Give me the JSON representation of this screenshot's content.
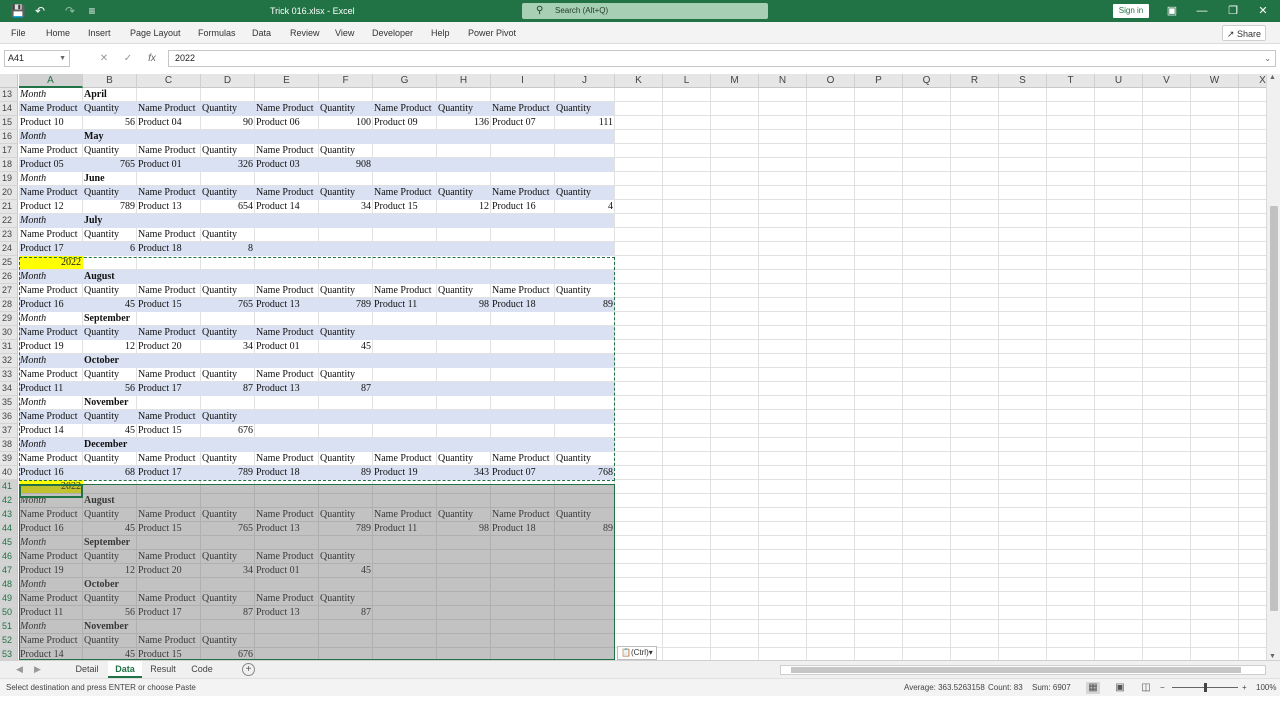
{
  "titlebar": {
    "doc_title": "Trick 016.xlsx  -  Excel",
    "search_placeholder": "Search (Alt+Q)",
    "signin_label": "Sign in",
    "icons": [
      "save-icon",
      "undo-icon",
      "redo-icon",
      "customize-icon"
    ],
    "accent": "#217346"
  },
  "menu": {
    "items": [
      "File",
      "Home",
      "Insert",
      "Page Layout",
      "Formulas",
      "Data",
      "Review",
      "View",
      "Developer",
      "Help",
      "Power Pivot"
    ],
    "share_label": "Share"
  },
  "formula_bar": {
    "name_box": "A41",
    "fx": "fx",
    "value": "2022"
  },
  "columns": [
    "A",
    "B",
    "C",
    "D",
    "E",
    "F",
    "G",
    "H",
    "I",
    "J",
    "K",
    "L",
    "M",
    "N",
    "O",
    "P",
    "Q",
    "R",
    "S",
    "T",
    "U",
    "V",
    "W",
    "X"
  ],
  "rows": [
    {
      "n": "13",
      "cells": [
        {
          "c": "A",
          "v": "Month",
          "s": "i"
        },
        {
          "c": "B",
          "v": "April",
          "s": "b"
        }
      ]
    },
    {
      "n": "14",
      "band": true,
      "cells": [
        {
          "c": "A",
          "v": "Name Product"
        },
        {
          "c": "B",
          "v": "Quantity"
        },
        {
          "c": "C",
          "v": "Name Product"
        },
        {
          "c": "D",
          "v": "Quantity"
        },
        {
          "c": "E",
          "v": "Name Product"
        },
        {
          "c": "F",
          "v": "Quantity"
        },
        {
          "c": "G",
          "v": "Name Product"
        },
        {
          "c": "H",
          "v": "Quantity"
        },
        {
          "c": "I",
          "v": "Name Product"
        },
        {
          "c": "J",
          "v": "Quantity"
        }
      ]
    },
    {
      "n": "15",
      "cells": [
        {
          "c": "A",
          "v": "Product 10"
        },
        {
          "c": "B",
          "v": "56",
          "s": "r"
        },
        {
          "c": "C",
          "v": "Product 04"
        },
        {
          "c": "D",
          "v": "90",
          "s": "r"
        },
        {
          "c": "E",
          "v": "Product 06"
        },
        {
          "c": "F",
          "v": "100",
          "s": "r"
        },
        {
          "c": "G",
          "v": "Product 09"
        },
        {
          "c": "H",
          "v": "136",
          "s": "r"
        },
        {
          "c": "I",
          "v": "Product 07"
        },
        {
          "c": "J",
          "v": "111",
          "s": "r"
        }
      ]
    },
    {
      "n": "16",
      "band": true,
      "cells": [
        {
          "c": "A",
          "v": "Month",
          "s": "i"
        },
        {
          "c": "B",
          "v": "May",
          "s": "b"
        }
      ]
    },
    {
      "n": "17",
      "cells": [
        {
          "c": "A",
          "v": "Name Product"
        },
        {
          "c": "B",
          "v": "Quantity"
        },
        {
          "c": "C",
          "v": "Name Product"
        },
        {
          "c": "D",
          "v": "Quantity"
        },
        {
          "c": "E",
          "v": "Name Product"
        },
        {
          "c": "F",
          "v": "Quantity"
        }
      ]
    },
    {
      "n": "18",
      "band": true,
      "cells": [
        {
          "c": "A",
          "v": "Product 05"
        },
        {
          "c": "B",
          "v": "765",
          "s": "r"
        },
        {
          "c": "C",
          "v": "Product 01"
        },
        {
          "c": "D",
          "v": "326",
          "s": "r"
        },
        {
          "c": "E",
          "v": "Product 03"
        },
        {
          "c": "F",
          "v": "908",
          "s": "r"
        }
      ]
    },
    {
      "n": "19",
      "cells": [
        {
          "c": "A",
          "v": "Month",
          "s": "i"
        },
        {
          "c": "B",
          "v": "June",
          "s": "b"
        }
      ]
    },
    {
      "n": "20",
      "band": true,
      "cells": [
        {
          "c": "A",
          "v": "Name Product"
        },
        {
          "c": "B",
          "v": "Quantity"
        },
        {
          "c": "C",
          "v": "Name Product"
        },
        {
          "c": "D",
          "v": "Quantity"
        },
        {
          "c": "E",
          "v": "Name Product"
        },
        {
          "c": "F",
          "v": "Quantity"
        },
        {
          "c": "G",
          "v": "Name Product"
        },
        {
          "c": "H",
          "v": "Quantity"
        },
        {
          "c": "I",
          "v": "Name Product"
        },
        {
          "c": "J",
          "v": "Quantity"
        }
      ]
    },
    {
      "n": "21",
      "cells": [
        {
          "c": "A",
          "v": "Product 12"
        },
        {
          "c": "B",
          "v": "789",
          "s": "r"
        },
        {
          "c": "C",
          "v": "Product 13"
        },
        {
          "c": "D",
          "v": "654",
          "s": "r"
        },
        {
          "c": "E",
          "v": "Product 14"
        },
        {
          "c": "F",
          "v": "34",
          "s": "r"
        },
        {
          "c": "G",
          "v": "Product 15"
        },
        {
          "c": "H",
          "v": "12",
          "s": "r"
        },
        {
          "c": "I",
          "v": "Product 16"
        },
        {
          "c": "J",
          "v": "4",
          "s": "r"
        }
      ]
    },
    {
      "n": "22",
      "band": true,
      "cells": [
        {
          "c": "A",
          "v": "Month",
          "s": "i"
        },
        {
          "c": "B",
          "v": "July",
          "s": "b"
        }
      ]
    },
    {
      "n": "23",
      "cells": [
        {
          "c": "A",
          "v": "Name Product"
        },
        {
          "c": "B",
          "v": "Quantity"
        },
        {
          "c": "C",
          "v": "Name Product"
        },
        {
          "c": "D",
          "v": "Quantity"
        }
      ]
    },
    {
      "n": "24",
      "band": true,
      "cells": [
        {
          "c": "A",
          "v": "Product 17"
        },
        {
          "c": "B",
          "v": "6",
          "s": "r"
        },
        {
          "c": "C",
          "v": "Product 18"
        },
        {
          "c": "D",
          "v": "8",
          "s": "r"
        }
      ]
    },
    {
      "n": "25",
      "year": true,
      "cells": [
        {
          "c": "A",
          "v": "2022",
          "s": "r"
        }
      ]
    },
    {
      "n": "26",
      "band": true,
      "cells": [
        {
          "c": "A",
          "v": "Month",
          "s": "i"
        },
        {
          "c": "B",
          "v": "August",
          "s": "b"
        }
      ]
    },
    {
      "n": "27",
      "cells": [
        {
          "c": "A",
          "v": "Name Product"
        },
        {
          "c": "B",
          "v": "Quantity"
        },
        {
          "c": "C",
          "v": "Name Product"
        },
        {
          "c": "D",
          "v": "Quantity"
        },
        {
          "c": "E",
          "v": "Name Product"
        },
        {
          "c": "F",
          "v": "Quantity"
        },
        {
          "c": "G",
          "v": "Name Product"
        },
        {
          "c": "H",
          "v": "Quantity"
        },
        {
          "c": "I",
          "v": "Name Product"
        },
        {
          "c": "J",
          "v": "Quantity"
        }
      ]
    },
    {
      "n": "28",
      "band": true,
      "cells": [
        {
          "c": "A",
          "v": "Product 16"
        },
        {
          "c": "B",
          "v": "45",
          "s": "r"
        },
        {
          "c": "C",
          "v": "Product 15"
        },
        {
          "c": "D",
          "v": "765",
          "s": "r"
        },
        {
          "c": "E",
          "v": "Product 13"
        },
        {
          "c": "F",
          "v": "789",
          "s": "r"
        },
        {
          "c": "G",
          "v": "Product 11"
        },
        {
          "c": "H",
          "v": "98",
          "s": "r"
        },
        {
          "c": "I",
          "v": "Product 18"
        },
        {
          "c": "J",
          "v": "89",
          "s": "r"
        }
      ]
    },
    {
      "n": "29",
      "cells": [
        {
          "c": "A",
          "v": "Month",
          "s": "i"
        },
        {
          "c": "B",
          "v": "September",
          "s": "b"
        }
      ]
    },
    {
      "n": "30",
      "band": true,
      "cells": [
        {
          "c": "A",
          "v": "Name Product"
        },
        {
          "c": "B",
          "v": "Quantity"
        },
        {
          "c": "C",
          "v": "Name Product"
        },
        {
          "c": "D",
          "v": "Quantity"
        },
        {
          "c": "E",
          "v": "Name Product"
        },
        {
          "c": "F",
          "v": "Quantity"
        }
      ]
    },
    {
      "n": "31",
      "cells": [
        {
          "c": "A",
          "v": "Product 19"
        },
        {
          "c": "B",
          "v": "12",
          "s": "r"
        },
        {
          "c": "C",
          "v": "Product 20"
        },
        {
          "c": "D",
          "v": "34",
          "s": "r"
        },
        {
          "c": "E",
          "v": "Product 01"
        },
        {
          "c": "F",
          "v": "45",
          "s": "r"
        }
      ]
    },
    {
      "n": "32",
      "band": true,
      "cells": [
        {
          "c": "A",
          "v": "Month",
          "s": "i"
        },
        {
          "c": "B",
          "v": "October",
          "s": "b"
        }
      ]
    },
    {
      "n": "33",
      "cells": [
        {
          "c": "A",
          "v": "Name Product"
        },
        {
          "c": "B",
          "v": "Quantity"
        },
        {
          "c": "C",
          "v": "Name Product"
        },
        {
          "c": "D",
          "v": "Quantity"
        },
        {
          "c": "E",
          "v": "Name Product"
        },
        {
          "c": "F",
          "v": "Quantity"
        }
      ]
    },
    {
      "n": "34",
      "band": true,
      "cells": [
        {
          "c": "A",
          "v": "Product 11"
        },
        {
          "c": "B",
          "v": "56",
          "s": "r"
        },
        {
          "c": "C",
          "v": "Product 17"
        },
        {
          "c": "D",
          "v": "87",
          "s": "r"
        },
        {
          "c": "E",
          "v": "Product 13"
        },
        {
          "c": "F",
          "v": "87",
          "s": "r"
        }
      ]
    },
    {
      "n": "35",
      "cells": [
        {
          "c": "A",
          "v": "Month",
          "s": "i"
        },
        {
          "c": "B",
          "v": "November",
          "s": "b"
        }
      ]
    },
    {
      "n": "36",
      "band": true,
      "cells": [
        {
          "c": "A",
          "v": "Name Product"
        },
        {
          "c": "B",
          "v": "Quantity"
        },
        {
          "c": "C",
          "v": "Name Product"
        },
        {
          "c": "D",
          "v": "Quantity"
        }
      ]
    },
    {
      "n": "37",
      "cells": [
        {
          "c": "A",
          "v": "Product 14"
        },
        {
          "c": "B",
          "v": "45",
          "s": "r"
        },
        {
          "c": "C",
          "v": "Product 15"
        },
        {
          "c": "D",
          "v": "676",
          "s": "r"
        }
      ]
    },
    {
      "n": "38",
      "band": true,
      "cells": [
        {
          "c": "A",
          "v": "Month",
          "s": "i"
        },
        {
          "c": "B",
          "v": "December",
          "s": "b"
        }
      ]
    },
    {
      "n": "39",
      "cells": [
        {
          "c": "A",
          "v": "Name Product"
        },
        {
          "c": "B",
          "v": "Quantity"
        },
        {
          "c": "C",
          "v": "Name Product"
        },
        {
          "c": "D",
          "v": "Quantity"
        },
        {
          "c": "E",
          "v": "Name Product"
        },
        {
          "c": "F",
          "v": "Quantity"
        },
        {
          "c": "G",
          "v": "Name Product"
        },
        {
          "c": "H",
          "v": "Quantity"
        },
        {
          "c": "I",
          "v": "Name Product"
        },
        {
          "c": "J",
          "v": "Quantity"
        }
      ]
    },
    {
      "n": "40",
      "band": true,
      "cells": [
        {
          "c": "A",
          "v": "Product 16"
        },
        {
          "c": "B",
          "v": "68",
          "s": "r"
        },
        {
          "c": "C",
          "v": "Product 17"
        },
        {
          "c": "D",
          "v": "789",
          "s": "r"
        },
        {
          "c": "E",
          "v": "Product 18"
        },
        {
          "c": "F",
          "v": "89",
          "s": "r"
        },
        {
          "c": "G",
          "v": "Product 19"
        },
        {
          "c": "H",
          "v": "343",
          "s": "r"
        },
        {
          "c": "I",
          "v": "Product 07"
        },
        {
          "c": "J",
          "v": "768",
          "s": "r"
        }
      ]
    },
    {
      "n": "41",
      "year": true,
      "cells": [
        {
          "c": "A",
          "v": "2022",
          "s": "r"
        }
      ]
    },
    {
      "n": "42",
      "cells": [
        {
          "c": "A",
          "v": "Month",
          "s": "i"
        },
        {
          "c": "B",
          "v": "August",
          "s": "b"
        }
      ]
    },
    {
      "n": "43",
      "cells": [
        {
          "c": "A",
          "v": "Name Product"
        },
        {
          "c": "B",
          "v": "Quantity"
        },
        {
          "c": "C",
          "v": "Name Product"
        },
        {
          "c": "D",
          "v": "Quantity"
        },
        {
          "c": "E",
          "v": "Name Product"
        },
        {
          "c": "F",
          "v": "Quantity"
        },
        {
          "c": "G",
          "v": "Name Product"
        },
        {
          "c": "H",
          "v": "Quantity"
        },
        {
          "c": "I",
          "v": "Name Product"
        },
        {
          "c": "J",
          "v": "Quantity"
        }
      ]
    },
    {
      "n": "44",
      "cells": [
        {
          "c": "A",
          "v": "Product 16"
        },
        {
          "c": "B",
          "v": "45",
          "s": "r"
        },
        {
          "c": "C",
          "v": "Product 15"
        },
        {
          "c": "D",
          "v": "765",
          "s": "r"
        },
        {
          "c": "E",
          "v": "Product 13"
        },
        {
          "c": "F",
          "v": "789",
          "s": "r"
        },
        {
          "c": "G",
          "v": "Product 11"
        },
        {
          "c": "H",
          "v": "98",
          "s": "r"
        },
        {
          "c": "I",
          "v": "Product 18"
        },
        {
          "c": "J",
          "v": "89",
          "s": "r"
        }
      ]
    },
    {
      "n": "45",
      "cells": [
        {
          "c": "A",
          "v": "Month",
          "s": "i"
        },
        {
          "c": "B",
          "v": "September",
          "s": "b"
        }
      ]
    },
    {
      "n": "46",
      "cells": [
        {
          "c": "A",
          "v": "Name Product"
        },
        {
          "c": "B",
          "v": "Quantity"
        },
        {
          "c": "C",
          "v": "Name Product"
        },
        {
          "c": "D",
          "v": "Quantity"
        },
        {
          "c": "E",
          "v": "Name Product"
        },
        {
          "c": "F",
          "v": "Quantity"
        }
      ]
    },
    {
      "n": "47",
      "cells": [
        {
          "c": "A",
          "v": "Product 19"
        },
        {
          "c": "B",
          "v": "12",
          "s": "r"
        },
        {
          "c": "C",
          "v": "Product 20"
        },
        {
          "c": "D",
          "v": "34",
          "s": "r"
        },
        {
          "c": "E",
          "v": "Product 01"
        },
        {
          "c": "F",
          "v": "45",
          "s": "r"
        }
      ]
    },
    {
      "n": "48",
      "cells": [
        {
          "c": "A",
          "v": "Month",
          "s": "i"
        },
        {
          "c": "B",
          "v": "October",
          "s": "b"
        }
      ]
    },
    {
      "n": "49",
      "cells": [
        {
          "c": "A",
          "v": "Name Product"
        },
        {
          "c": "B",
          "v": "Quantity"
        },
        {
          "c": "C",
          "v": "Name Product"
        },
        {
          "c": "D",
          "v": "Quantity"
        },
        {
          "c": "E",
          "v": "Name Product"
        },
        {
          "c": "F",
          "v": "Quantity"
        }
      ]
    },
    {
      "n": "50",
      "cells": [
        {
          "c": "A",
          "v": "Product 11"
        },
        {
          "c": "B",
          "v": "56",
          "s": "r"
        },
        {
          "c": "C",
          "v": "Product 17"
        },
        {
          "c": "D",
          "v": "87",
          "s": "r"
        },
        {
          "c": "E",
          "v": "Product 13"
        },
        {
          "c": "F",
          "v": "87",
          "s": "r"
        }
      ]
    },
    {
      "n": "51",
      "cells": [
        {
          "c": "A",
          "v": "Month",
          "s": "i"
        },
        {
          "c": "B",
          "v": "November",
          "s": "b"
        }
      ]
    },
    {
      "n": "52",
      "cells": [
        {
          "c": "A",
          "v": "Name Product"
        },
        {
          "c": "B",
          "v": "Quantity"
        },
        {
          "c": "C",
          "v": "Name Product"
        },
        {
          "c": "D",
          "v": "Quantity"
        }
      ]
    },
    {
      "n": "53",
      "cells": [
        {
          "c": "A",
          "v": "Product 14"
        },
        {
          "c": "B",
          "v": "45",
          "s": "r"
        },
        {
          "c": "C",
          "v": "Product 15"
        },
        {
          "c": "D",
          "v": "676",
          "s": "r"
        }
      ]
    }
  ],
  "paste_options_label": "(Ctrl)",
  "sheet_tabs": [
    "Detail",
    "Data",
    "Result",
    "Code"
  ],
  "active_sheet": "Data",
  "status": {
    "message": "Select destination and press ENTER or choose Paste",
    "average": "Average: 363.5263158",
    "count": "Count: 83",
    "sum": "Sum: 6907",
    "zoom": "100%"
  },
  "colors": {
    "band": "#d9e1f2",
    "highlight": "#ffff00",
    "excel_green": "#217346"
  }
}
